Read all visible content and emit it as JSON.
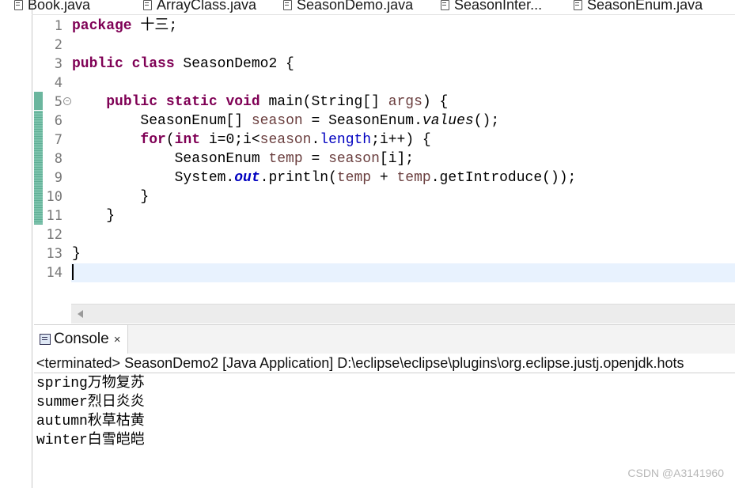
{
  "tabs": [
    {
      "label": "Book.java"
    },
    {
      "label": "ArrayClass.java"
    },
    {
      "label": "SeasonDemo.java"
    },
    {
      "label": "SeasonInter..."
    },
    {
      "label": "SeasonEnum.java"
    }
  ],
  "editor": {
    "line_numbers": [
      "1",
      "2",
      "3",
      "4",
      "5",
      "6",
      "7",
      "8",
      "9",
      "10",
      "11",
      "12",
      "13",
      "14"
    ],
    "lines": {
      "l1": {
        "kw": "package",
        "rest": " 十三;"
      },
      "l3": {
        "kw": "public class",
        "rest": " SeasonDemo2 {"
      },
      "l5": {
        "indent": "    ",
        "kw": "public static void",
        "rest1": " main(String[] ",
        "var": "args",
        "rest2": ") {"
      },
      "l6": {
        "indent": "        ",
        "a": "SeasonEnum[] ",
        "var": "season",
        "b": " = SeasonEnum.",
        "ital": "values",
        "c": "();"
      },
      "l7": {
        "indent": "        ",
        "kw1": "for",
        "a": "(",
        "kw2": "int",
        "b": " i=0;i<",
        "var": "season",
        "c": ".",
        "fld": "length",
        "d": ";i++) {"
      },
      "l8": {
        "indent": "            ",
        "a": "SeasonEnum ",
        "var1": "temp",
        "b": " = ",
        "var2": "season",
        "c": "[i];"
      },
      "l9": {
        "indent": "            ",
        "a": "System.",
        "sfld": "out",
        "b": ".println(",
        "var1": "temp",
        "c": " + ",
        "var2": "temp",
        "d": ".getIntroduce());"
      },
      "l10": {
        "text": "        }"
      },
      "l11": {
        "text": "    }"
      },
      "l13": {
        "text": "}"
      }
    }
  },
  "console": {
    "tab_label": "Console",
    "close_glyph": "×",
    "status": "<terminated> SeasonDemo2 [Java Application] D:\\eclipse\\eclipse\\plugins\\org.eclipse.justj.openjdk.hots",
    "output": [
      "spring万物复苏",
      "summer烈日炎炎",
      "autumn秋草枯黄",
      "winter白雪皑皑"
    ]
  },
  "watermark": "CSDN @A3141960"
}
